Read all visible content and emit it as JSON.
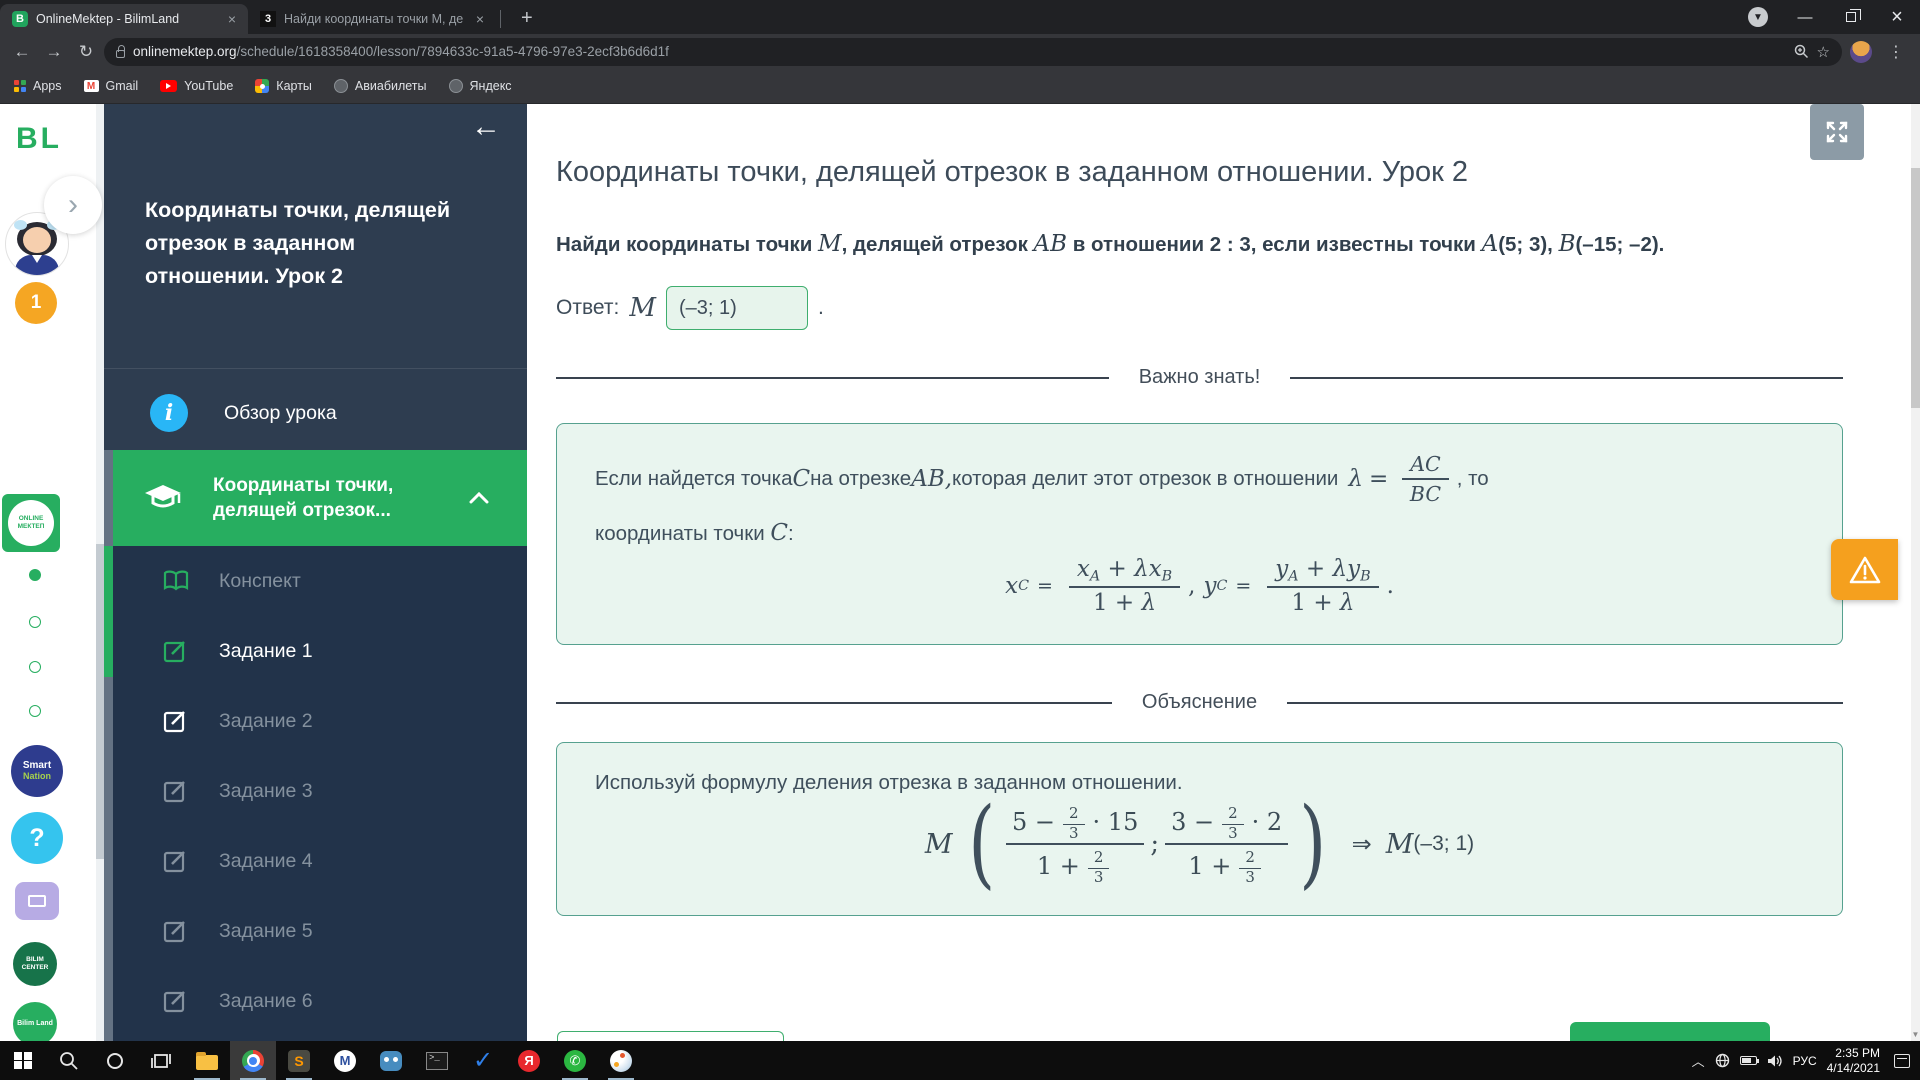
{
  "browser": {
    "tab1": {
      "title": "OnlineMektep - BilimLand",
      "favicon": "B",
      "close": "×"
    },
    "tab2": {
      "title": "Найди координаты точки М, де",
      "favicon": "3",
      "close": "×"
    },
    "new_tab": "+",
    "nav": {
      "back": "←",
      "forward": "→",
      "reload": "↻"
    },
    "url": {
      "domain": "onlinemektep.org",
      "path": "/schedule/1618358400/lesson/7894633c-91a5-4796-97e3-2ecf3b6d6d1f"
    },
    "pill": {
      "star": "☆"
    },
    "kebab": "⋮",
    "window": {
      "chevron": "▼",
      "minimize": "—",
      "close": "×"
    },
    "bookmarks": {
      "apps": "Apps",
      "gmail": "Gmail",
      "youtube": "YouTube",
      "maps": "Карты",
      "avia": "Авиабилеты",
      "yandex": "Яндекс"
    }
  },
  "rail": {
    "logo": "BL",
    "chevron": "›",
    "badge_count": "1",
    "online_mektep": "ONLINE МЕКТЕП",
    "smart": "Smart",
    "nation": "Nation",
    "help": "?",
    "bilim_center": "BILIM CENTER",
    "bilim_land": "Bilim Land"
  },
  "sidebar": {
    "back_arrow": "←",
    "lesson_title": "Координаты точки, делящей отрезок в заданном отношении. Урок 2",
    "overview_label": "Обзор урока",
    "overview_icon": "i",
    "section_title": "Координаты точки, делящей отрезок...",
    "items": [
      {
        "label": "Конспект"
      },
      {
        "label": "Задание 1"
      },
      {
        "label": "Задание 2"
      },
      {
        "label": "Задание 3"
      },
      {
        "label": "Задание 4"
      },
      {
        "label": "Задание 5"
      },
      {
        "label": "Задание 6"
      }
    ]
  },
  "content": {
    "page_title": "Координаты точки, делящей отрезок в заданном отношении. Урок 2",
    "question": {
      "p1": "Найди координаты точки ",
      "m": "M",
      "p2": ", делящей отрезок ",
      "ab": "AB",
      "p3": " в отношении 2 : 3, если известны точки ",
      "a": "A",
      "a_coords": "(5; 3),",
      "b": "B",
      "b_coords": "(–15; –2)."
    },
    "answer": {
      "label": "Ответ:",
      "m": "M",
      "value": "(–3; 1)",
      "period": "."
    },
    "important": {
      "heading": "Важно знать!",
      "t1": "Если найдется точка ",
      "c": "C",
      "t2": " на отрезке ",
      "ab": "AB,",
      "t3": " которая делит этот отрезок в отношении ",
      "lam": "λ",
      "eq": "=",
      "frac_num": "AC",
      "frac_den": "BC",
      "t4": ", то",
      "t5": "координаты точки ",
      "c2": "C",
      "colon": ":",
      "f": {
        "x": "x",
        "y": "y",
        "A": "A",
        "B": "B",
        "C": "C",
        "eq": "=",
        "plus": " + ",
        "lam": "λ",
        "den": "1 + ",
        "comma": ", ",
        "period": "."
      }
    },
    "explanation": {
      "heading": "Объяснение",
      "text": "Используй формулу деления отрезка в заданном отношении.",
      "f": {
        "m": "M",
        "lp": "(",
        "rp": ")",
        "x_n1": "5 −",
        "x_n2": "· 15",
        "y_n1": "3 −",
        "y_n2": "· 2",
        "den": "1 +",
        "two": "2",
        "three": "3",
        "semi": ";",
        "implies": "⇒",
        "m2": "M",
        "result": "(–3; 1)"
      }
    },
    "scroll_down_arrow": "▼"
  },
  "taskbar": {
    "lang": "РУС",
    "time": "2:35 PM",
    "date": "4/14/2021",
    "tray_chevron": "︿",
    "sublime": "S",
    "mw": "M",
    "terminal": ">_",
    "check": "✓",
    "yandex": "Я",
    "whatsapp": "✆"
  }
}
